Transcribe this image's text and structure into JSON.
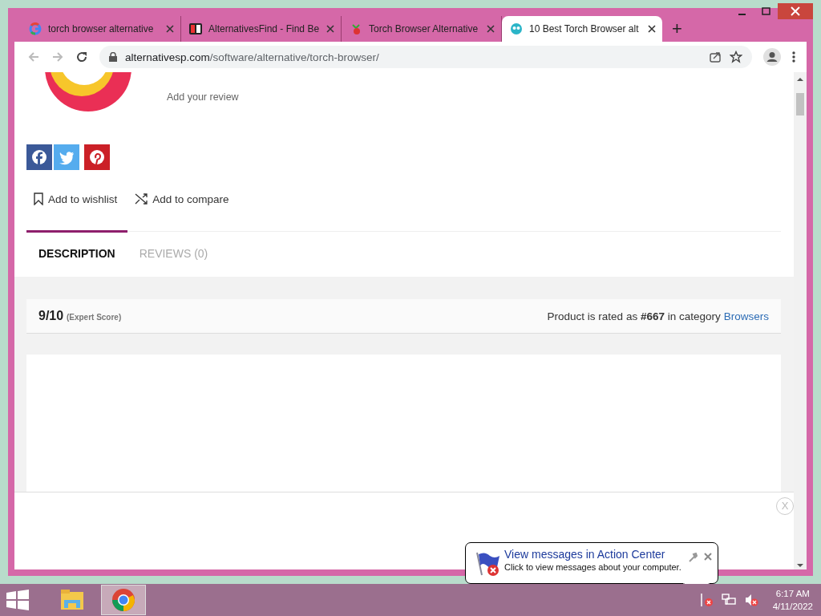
{
  "browser": {
    "tabs": [
      {
        "kind": "google",
        "title": "torch browser alternative",
        "selected": false
      },
      {
        "kind": "altfind",
        "title": "AlternativesFind - Find Be",
        "selected": false
      },
      {
        "kind": "torch",
        "title": "Torch Browser Alternative",
        "selected": false
      },
      {
        "kind": "altsp",
        "title": "10 Best Torch Browser alt",
        "selected": true
      }
    ],
    "new_tab": "+",
    "url_host": "alternativesp.com",
    "url_path": "/software/alternative/torch-browser/"
  },
  "page": {
    "add_review": "Add your review",
    "share_buttons": [
      {
        "kind": "facebook"
      },
      {
        "kind": "twitter"
      },
      {
        "kind": "pinterest"
      }
    ],
    "actions": [
      {
        "kind": "wishlist",
        "label": "Add to wishlist"
      },
      {
        "kind": "compare",
        "label": "Add to compare"
      }
    ],
    "content_tabs": [
      {
        "label": "DESCRIPTION",
        "selected": true
      },
      {
        "label": "REVIEWS (0)",
        "selected": false
      }
    ],
    "score": {
      "value": "9/10",
      "note": "(Expert Score)"
    },
    "rating": "Product is rated as **#667** in category",
    "category_link": "Browsers",
    "ad_close": "X"
  },
  "notification": {
    "title": "View messages in Action Center",
    "message": "Click to view messages about your computer."
  },
  "taskbar": {
    "apps": [
      {
        "kind": "explorer",
        "selected": false
      },
      {
        "kind": "chrome",
        "selected": true
      }
    ],
    "time": "6:17 AM",
    "date": "4/11/2022"
  }
}
